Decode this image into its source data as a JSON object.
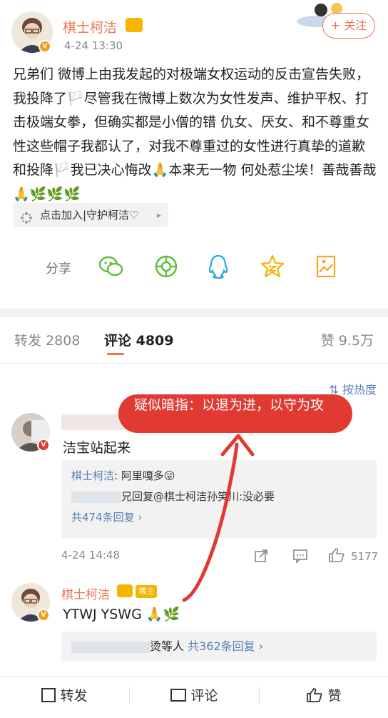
{
  "header": {
    "username": "棋士柯洁",
    "time": "4-24 13:30",
    "follow_label": "+ 关注"
  },
  "post": {
    "text": "兄弟们 微博上由我发起的对极端女权运动的反击宣告失败，我投降了🏳️尽管我在微博上数次为女性发声、维护平权、打击极端女拳，但确实都是小僧的错 仇女、厌女、和不尊重女性这些帽子我都认了，对我不尊重过的女性进行真挚的道歉和投降🏳️我已决心悔改🙏本来无一物 何处惹尘埃！善哉善哉🙏🌿🌿🌿"
  },
  "chip": {
    "label": "点击加入|守护柯洁♡"
  },
  "share": {
    "label": "分享",
    "icons": [
      "wechat-icon",
      "moments-icon",
      "qq-icon",
      "qzone-icon",
      "screenshot-icon"
    ]
  },
  "tabs": {
    "repost": "转发 2808",
    "comment": "评论 4809",
    "like": "赞 9.5万"
  },
  "sort_label": "按热度",
  "annotation": "疑似暗指：以退为进，以守为攻",
  "comment1": {
    "text": "洁宝站起来",
    "reply1_name": "棋士柯洁",
    "reply1_text": ": 阿里嘎多😜",
    "reply2_text": "兄回复@棋士柯洁孙笑川:没必要",
    "reply_count": "共474条回复 ›",
    "time": "4-24 14:48",
    "likes": "5177"
  },
  "comment2": {
    "name": "棋士柯洁",
    "badge": "博主",
    "text": "YTWJ YSWG 🙏🌿",
    "others": "烫等人",
    "reply_count": "共362条回复 ›"
  },
  "bottom_bar": {
    "repost": "转发",
    "comment": "评论",
    "like": "赞"
  }
}
